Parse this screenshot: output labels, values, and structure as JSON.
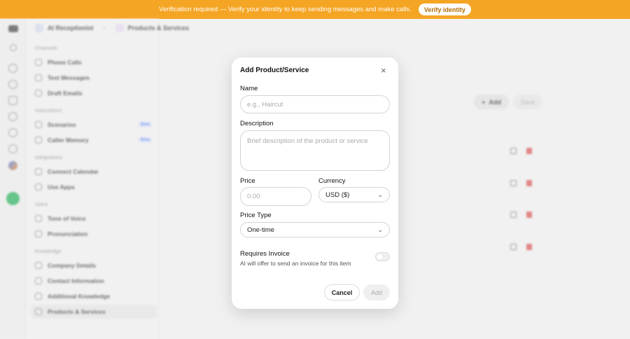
{
  "banner": {
    "message": "Verification required — Verify your identity to keep sending messages and make calls.",
    "button": "Verify identity",
    "color": "#f5a524"
  },
  "breadcrumb": {
    "root": "AI Receptionist",
    "current": "Products & Services"
  },
  "sidebar": {
    "sections": [
      {
        "title": "Channels",
        "items": [
          {
            "label": "Phone Calls"
          },
          {
            "label": "Text Messages"
          },
          {
            "label": "Draft Emails"
          }
        ]
      },
      {
        "title": "Instructions",
        "items": [
          {
            "label": "Scenarios",
            "badge": "Beta"
          },
          {
            "label": "Caller Memory",
            "badge": "Beta"
          }
        ]
      },
      {
        "title": "Integrations",
        "items": [
          {
            "label": "Connect Calendar"
          },
          {
            "label": "Use Apps"
          }
        ]
      },
      {
        "title": "Voice",
        "items": [
          {
            "label": "Tone of Voice"
          },
          {
            "label": "Pronunciation"
          }
        ]
      },
      {
        "title": "Knowledge",
        "items": [
          {
            "label": "Company Details"
          },
          {
            "label": "Contact Information"
          },
          {
            "label": "Additional Knowledge"
          },
          {
            "label": "Products & Services",
            "active": true
          }
        ]
      }
    ]
  },
  "page": {
    "add_label": "Add",
    "save_label": "Save"
  },
  "modal": {
    "title": "Add Product/Service",
    "name_label": "Name",
    "name_placeholder": "e.g., Haircut",
    "description_label": "Description",
    "description_placeholder": "Brief description of the product or service",
    "price_label": "Price",
    "price_placeholder": "0.00",
    "currency_label": "Currency",
    "currency_value": "USD ($)",
    "price_type_label": "Price Type",
    "price_type_value": "One-time",
    "requires_invoice_label": "Requires Invoice",
    "requires_invoice_help": "AI will offer to send an invoice for this item",
    "requires_invoice_on": false,
    "cancel_label": "Cancel",
    "add_label": "Add"
  }
}
